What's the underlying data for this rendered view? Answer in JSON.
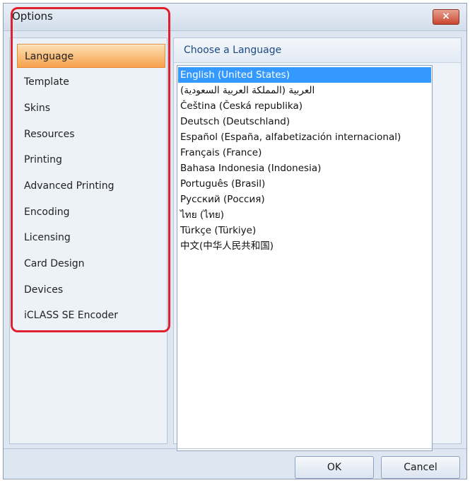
{
  "window": {
    "title": "Options",
    "close_label": "×"
  },
  "sidebar": {
    "items": [
      {
        "label": "Language",
        "active": true
      },
      {
        "label": "Template"
      },
      {
        "label": "Skins"
      },
      {
        "label": "Resources"
      },
      {
        "label": "Printing"
      },
      {
        "label": "Advanced Printing"
      },
      {
        "label": "Encoding"
      },
      {
        "label": "Licensing"
      },
      {
        "label": "Card Design"
      },
      {
        "label": "Devices"
      },
      {
        "label": "iCLASS SE Encoder"
      }
    ]
  },
  "panel": {
    "header": "Choose a Language",
    "languages": [
      {
        "label": "English (United States)",
        "selected": true
      },
      {
        "label": "(العربية (المملكة العربية السعودية"
      },
      {
        "label": "Čeština (Česká republika)"
      },
      {
        "label": "Deutsch (Deutschland)"
      },
      {
        "label": "Español (España, alfabetización internacional)"
      },
      {
        "label": "Français (France)"
      },
      {
        "label": "Bahasa Indonesia (Indonesia)"
      },
      {
        "label": "Português (Brasil)"
      },
      {
        "label": "Русский (Россия)"
      },
      {
        "label": "ไทย (ไทย)"
      },
      {
        "label": "Türkçe (Türkiye)"
      },
      {
        "label": "中文(中华人民共和国)"
      }
    ]
  },
  "buttons": {
    "ok": "OK",
    "cancel": "Cancel"
  },
  "colors": {
    "selection": "#3399ff",
    "active_nav": "#f7a24d",
    "highlight_border": "#e0202e"
  }
}
